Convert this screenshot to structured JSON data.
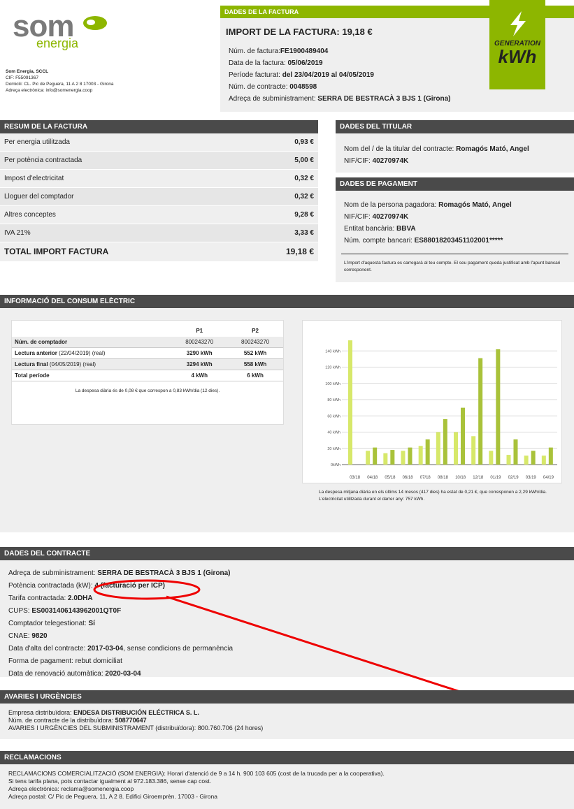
{
  "brand": {
    "name": "som",
    "sub": "energia"
  },
  "company": {
    "line1": "Som Energia, SCCL",
    "line2": "CIF: F55091367",
    "line3": "Domicili: CL. Pic de Peguera, 11 A 2 8 17003 - Girona",
    "line4": "Adreça electrònica: info@somenergia.coop"
  },
  "factura": {
    "header": "DADES DE LA FACTURA",
    "import": "IMPORT DE LA FACTURA: 19,18 €",
    "num_label": "Núm. de factura:",
    "num_value": "FE1900489404",
    "data_label": "Data de la factura:",
    "data_value": "05/06/2019",
    "periode_label": "Període facturat:",
    "periode_value": "del 23/04/2019 al 04/05/2019",
    "contracte_label": "Núm. de contracte:",
    "contracte_value": "0048598",
    "adreca_label": "Adreça de subministrament:",
    "adreca_value": "SERRA DE BESTRACÀ 3 BJS 1 (Girona)"
  },
  "gen": {
    "line1": "GENERATION",
    "line2": "kWh"
  },
  "resum": {
    "header": "RESUM DE LA FACTURA",
    "rows": [
      {
        "label": "Per energia utilitzada",
        "value": "0,93 €"
      },
      {
        "label": "Per potència contractada",
        "value": "5,00 €"
      },
      {
        "label": "Impost d'electricitat",
        "value": "0,32 €"
      },
      {
        "label": "Lloguer del comptador",
        "value": "0,32 €"
      },
      {
        "label": "Altres conceptes",
        "value": "9,28 €"
      },
      {
        "label": "IVA 21%",
        "value": "3,33 €"
      }
    ],
    "total_label": "TOTAL IMPORT FACTURA",
    "total_value": "19,18 €"
  },
  "titular": {
    "header": "DADES DEL TITULAR",
    "nom_label": "Nom del / de la titular del contracte:",
    "nom_value": "Romagós Mató, Angel",
    "nif_label": "NIF/CIF:",
    "nif_value": "40270974K"
  },
  "pagament": {
    "header": "DADES DE PAGAMENT",
    "nom_label": "Nom de la persona pagadora:",
    "nom_value": "Romagós Mató, Angel",
    "nif_label": "NIF/CIF:",
    "nif_value": "40270974K",
    "entitat_label": "Entitat bancària:",
    "entitat_value": "BBVA",
    "compte_label": "Núm. compte bancari:",
    "compte_value": "ES8801820345110​2001*****",
    "note": "L'import d'aquesta factura es carregarà al teu compte. El seu pagament queda justificat amb l'apunt bancari corresponent."
  },
  "consum": {
    "header": "INFORMACIÓ DEL CONSUM ELÈCTRIC",
    "table": {
      "cols": [
        "",
        "P1",
        "P2"
      ],
      "rows": [
        {
          "label": "Núm. de comptador",
          "sub": "",
          "p1": "800243270",
          "p2": "800243270"
        },
        {
          "label": "Lectura anterior",
          "sub": "(22/04/2019) (real)",
          "p1": "3290 kWh",
          "p2": "552 kWh"
        },
        {
          "label": "Lectura final",
          "sub": "(04/05/2019) (real)",
          "p1": "3294 kWh",
          "p2": "558 kWh"
        },
        {
          "label": "Total període",
          "sub": "",
          "p1": "4 kWh",
          "p2": "6 kWh"
        }
      ],
      "note": "La despesa diària és de 0,08 € que correspon a 0,83 kWh/dia (12 dies)."
    },
    "note1": "La despesa mitjana diària en els últims 14 mesos (417 dies) ha estat de  0,21 €, que corresponen a 2,29 kWh/dia.",
    "note2": "L'electricitat utilitzada durant el darrer any: 757 kWh."
  },
  "chart_data": {
    "type": "bar",
    "categories": [
      "03/18",
      "04/18",
      "05/18",
      "06/18",
      "07/18",
      "08/18",
      "10/18",
      "12/18",
      "01/19",
      "02/19",
      "03/19",
      "04/19"
    ],
    "ylim": [
      0,
      160
    ],
    "yticks": [
      "0kWh",
      "20 kWh",
      "40 kWh",
      "60 kWh",
      "80 kWh",
      "100 kWh",
      "120 kWh",
      "140 kWh"
    ],
    "series": [
      {
        "values": [
          153,
          17,
          14,
          17,
          23,
          40,
          40,
          35,
          17,
          12,
          11,
          11
        ]
      },
      {
        "values": [
          0,
          21,
          18,
          21,
          31,
          56,
          70,
          131,
          142,
          31,
          17,
          21
        ]
      }
    ],
    "colors": [
      "#d7e86a",
      "#a9c23a"
    ]
  },
  "contracte": {
    "header": "DADES DEL CONTRACTE",
    "lines": [
      {
        "label": "Adreça de subministrament:",
        "value": "SERRA DE BESTRACÀ 3 BJS 1 (Girona)"
      },
      {
        "label": "Potència contractada (kW):",
        "value": "4 (facturació per ICP)"
      },
      {
        "label": "Tarifa contractada:",
        "value": "2.0DHA"
      },
      {
        "label": "CUPS:",
        "value": "ES0031406143962001QT0F"
      },
      {
        "label": "Comptador telegestionat:",
        "value": "Sí"
      },
      {
        "label": "CNAE:",
        "value": "9820"
      },
      {
        "label": "Data d'alta del contracte:",
        "value": "2017-03-04",
        "extra": ", sense condicions de permanència"
      },
      {
        "label": "Forma de pagament: rebut domiciliat",
        "value": ""
      },
      {
        "label": "Data de renovació automàtica:",
        "value": "2020-03-04"
      }
    ]
  },
  "avaries": {
    "header": "AVARIES I URGÈNCIES",
    "l1_label": "Empresa distribuïdora:",
    "l1_value": "ENDESA DISTRIBUCIÓN ELÉCTRICA S. L.",
    "l2_label": "Núm. de contracte de la distribuïdora:",
    "l2_value": "508770647",
    "l3": "AVARIES I URGÈNCIES DEL SUBMINISTRAMENT (distribuïdora): 800.760.706 (24 hores)"
  },
  "reclamacions": {
    "header": "RECLAMACIONS",
    "l1": "RECLAMACIONS COMERCIALITZACIÓ (SOM ENERGIA): Horari d'atenció de 9 a 14 h. 900 103 605 (cost de la trucada per a la cooperativa).",
    "l2": "Si tens tarifa plana, pots contactar igualment al 972.183.386, sense cap cost.",
    "l3": "Adreça electrònica: reclama@somenergia.coop",
    "l4": "Adreça postal: C/ Pic de Peguera, 11, A 2 8. Edifici Giroemprèn. 17003 - Girona"
  }
}
